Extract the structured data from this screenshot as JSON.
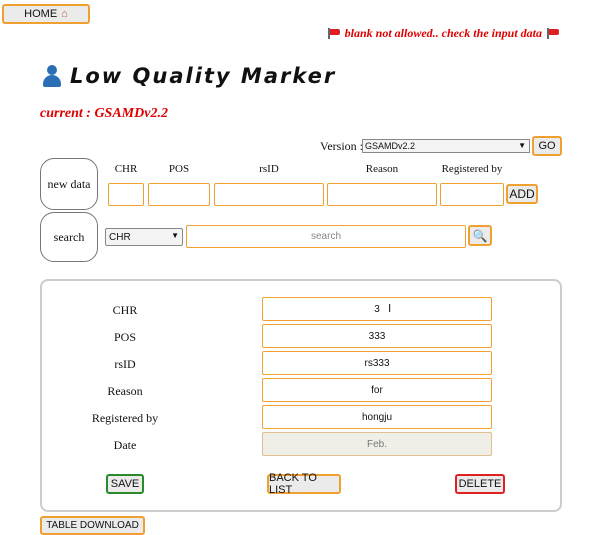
{
  "header": {
    "home_label": "HOME",
    "home_icon": "house-icon",
    "alert_text": "blank not allowed.. check the input data",
    "alert_icon": "flag-icon",
    "alert_color": "#e00000"
  },
  "page": {
    "title": "Low Quality Marker",
    "title_icon": "person-icon",
    "current_label": "current : GSAMDv2.2"
  },
  "version": {
    "label": "Version :",
    "selected": "GSAMDv2.2",
    "go_label": "GO"
  },
  "new_data": {
    "button_label": "new data",
    "columns": [
      "CHR",
      "POS",
      "rsID",
      "Reason",
      "Registered by"
    ],
    "add_label": "ADD"
  },
  "search": {
    "button_label": "search",
    "field_selected": "CHR",
    "placeholder": "search",
    "search_icon": "magnifier-icon"
  },
  "detail": {
    "fields": [
      {
        "label": "CHR",
        "value": "3"
      },
      {
        "label": "POS",
        "value": "333"
      },
      {
        "label": "rsID",
        "value": "rs333"
      },
      {
        "label": "Reason",
        "value": "for"
      },
      {
        "label": "Registered by",
        "value": "hongju"
      },
      {
        "label": "Date",
        "value": "Feb."
      }
    ],
    "save_label": "SAVE",
    "back_label": "BACK TO LIST",
    "delete_label": "DELETE"
  },
  "footer": {
    "table_download_label": "TABLE DOWNLOAD"
  },
  "colors": {
    "accent_border": "#f0a030",
    "save_border": "#2a8a2a",
    "delete_border": "#e02020"
  }
}
